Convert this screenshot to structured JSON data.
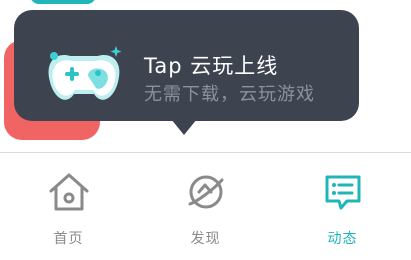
{
  "tooltip": {
    "title": "Tap 云玩上线",
    "subtitle": "无需下载，云玩游戏",
    "icon": "gamepad-icon"
  },
  "bottom_nav": {
    "tabs": [
      {
        "label": "首页",
        "icon": "home-icon",
        "active": false
      },
      {
        "label": "发现",
        "icon": "planet-icon",
        "active": false
      },
      {
        "label": "动态",
        "icon": "chat-bubble-icon",
        "active": true
      }
    ]
  },
  "colors": {
    "accent": "#1fb5b9",
    "tooltip_bg": "#3e4350",
    "inactive": "#8a8a8a"
  }
}
